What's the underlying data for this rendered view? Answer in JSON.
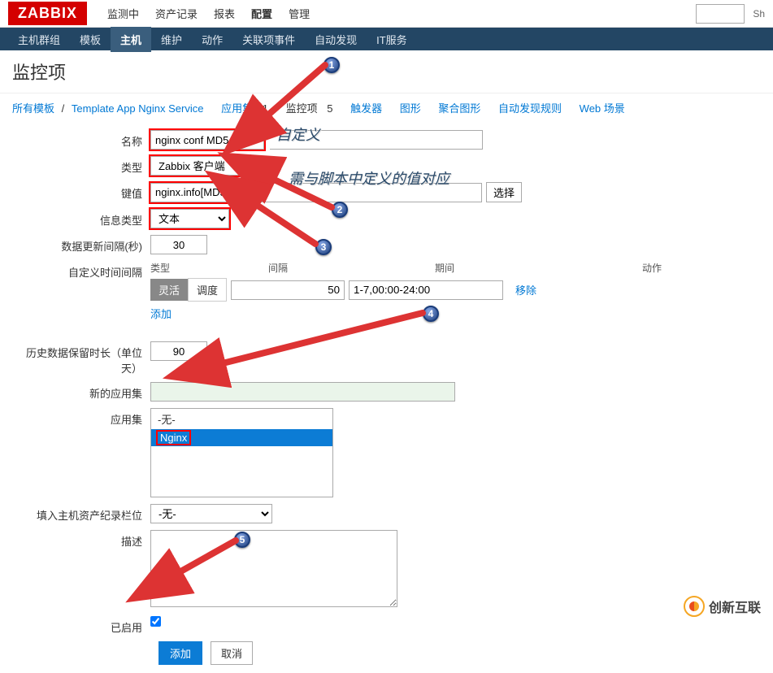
{
  "header": {
    "logo": "ZABBIX",
    "menu": [
      "监测中",
      "资产记录",
      "报表",
      "配置",
      "管理"
    ],
    "active_menu": 3,
    "share": "Sh"
  },
  "navbar": {
    "items": [
      "主机群组",
      "模板",
      "主机",
      "维护",
      "动作",
      "关联项事件",
      "自动发现",
      "IT服务"
    ],
    "active": 2
  },
  "page": {
    "title": "监控项"
  },
  "breadcrumb": {
    "all_templates": "所有模板",
    "template_name": "Template App Nginx Service",
    "app_set_label": "应用集",
    "app_set_count": "1",
    "item_label": "监控项",
    "item_count": "5",
    "trigger": "触发器",
    "graph": "图形",
    "aggregate": "聚合图形",
    "discovery": "自动发现规则",
    "web": "Web 场景"
  },
  "form": {
    "name_label": "名称",
    "name_value": "nginx conf MD5",
    "type_label": "类型",
    "type_value": "Zabbix 客户端",
    "key_label": "键值",
    "key_value": "nginx.info[MD5]",
    "key_select_btn": "选择",
    "datatype_label": "信息类型",
    "datatype_value": "文本",
    "interval_label": "数据更新间隔(秒)",
    "interval_value": "30",
    "custom_interval_label": "自定义时间间隔",
    "custom_interval": {
      "col_type": "类型",
      "col_interval": "间隔",
      "col_period": "期间",
      "col_action": "动作",
      "tab_active": "灵活",
      "tab_inactive": "调度",
      "interval_val": "50",
      "period_val": "1-7,00:00-24:00",
      "remove": "移除",
      "add": "添加"
    },
    "history_label": "历史数据保留时长（单位天）",
    "history_value": "90",
    "new_appset_label": "新的应用集",
    "new_appset_value": "",
    "appset_label": "应用集",
    "appset_options": [
      "-无-",
      "Nginx"
    ],
    "appset_selected": "Nginx",
    "inventory_label": "填入主机资产纪录栏位",
    "inventory_value": "-无-",
    "desc_label": "描述",
    "desc_value": "",
    "enabled_label": "已启用",
    "enabled_checked": true,
    "btn_add": "添加",
    "btn_cancel": "取消"
  },
  "annotations": {
    "custom_def": "自定义",
    "match_script": "需与脚本中定义的值对应"
  },
  "callouts": [
    "1",
    "2",
    "3",
    "4",
    "5"
  ],
  "footer": {
    "brand": "创新互联"
  }
}
